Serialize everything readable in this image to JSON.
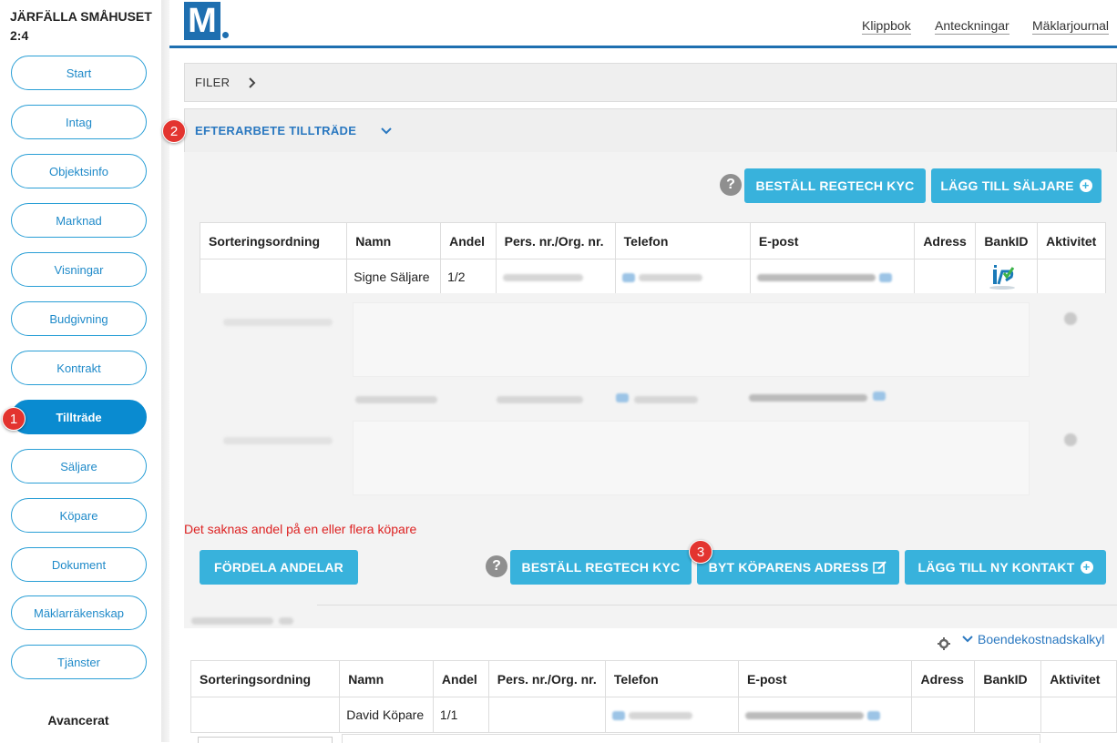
{
  "sidebar": {
    "property_title": "JÄRFÄLLA SMÅHUSET 2:4",
    "items": [
      {
        "label": "Start"
      },
      {
        "label": "Intag"
      },
      {
        "label": "Objektsinfo"
      },
      {
        "label": "Marknad"
      },
      {
        "label": "Visningar"
      },
      {
        "label": "Budgivning"
      },
      {
        "label": "Kontrakt"
      },
      {
        "label": "Tillträde"
      },
      {
        "label": "Säljare"
      },
      {
        "label": "Köpare"
      },
      {
        "label": "Dokument"
      },
      {
        "label": "Mäklarräkenskap"
      },
      {
        "label": "Tjänster"
      }
    ],
    "active_item": "Tillträde",
    "advanced_label": "Avancerat"
  },
  "header": {
    "logo_text": "M",
    "links": [
      "Klippbok",
      "Anteckningar",
      "Mäklarjournal"
    ]
  },
  "markers": [
    "1",
    "2",
    "3"
  ],
  "sections": {
    "files": {
      "label": "FILER"
    },
    "after_work": {
      "label": "EFTERARBETE TILLTRÄDE"
    }
  },
  "sellers": {
    "help_icon": "question-icon",
    "order_kyc_label": "BESTÄLL REGTECH KYC",
    "add_seller_label": "LÄGG TILL SÄLJARE",
    "columns": [
      "Sorteringsordning",
      "Namn",
      "Andel",
      "Pers. nr./Org. nr.",
      "Telefon",
      "E-post",
      "Adress",
      "BankID",
      "Aktivitet"
    ],
    "rows": [
      {
        "name": "Signe Säljare",
        "share": "1/2"
      }
    ]
  },
  "buyers": {
    "warning": "Det saknas andel på en eller flera köpare",
    "distribute_label": "FÖRDELA ANDELAR",
    "order_kyc_label": "BESTÄLL REGTECH KYC",
    "change_address_label": "BYT KÖPARENS ADRESS",
    "add_contact_label": "LÄGG TILL NY KONTAKT",
    "housing_cost_label": "Boendekostnadskalkyl",
    "columns": [
      "Sorteringsordning",
      "Namn",
      "Andel",
      "Pers. nr./Org. nr.",
      "Telefon",
      "E-post",
      "Adress",
      "BankID",
      "Aktivitet"
    ],
    "rows": [
      {
        "name": "David Köpare",
        "share": "1/1"
      }
    ]
  },
  "colors": {
    "accent": "#38b2dc",
    "brand": "#1e6fb0",
    "active_nav": "#0a8bd0",
    "warning": "#dd2222",
    "marker": "#e3342f"
  }
}
